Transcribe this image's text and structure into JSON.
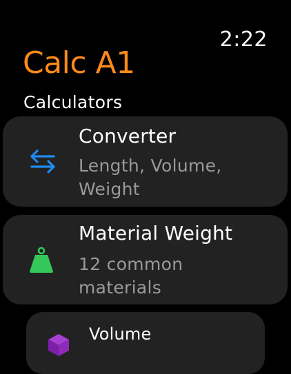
{
  "status": {
    "time": "2:22"
  },
  "app": {
    "title": "Calc A1",
    "accent_color": "#ff8a1c"
  },
  "section": {
    "heading": "Calculators"
  },
  "items": [
    {
      "title": "Converter",
      "subtitle": "Length, Volume, Weight",
      "icon": "arrows-left-right-icon",
      "icon_color": "#1e8cf2"
    },
    {
      "title": "Material Weight",
      "subtitle": "12 common materials",
      "icon": "kettlebell-weight-icon",
      "icon_color": "#34c759"
    },
    {
      "title": "Volume",
      "subtitle": "",
      "icon": "cube-icon",
      "icon_color": "#8e2bb8"
    }
  ]
}
